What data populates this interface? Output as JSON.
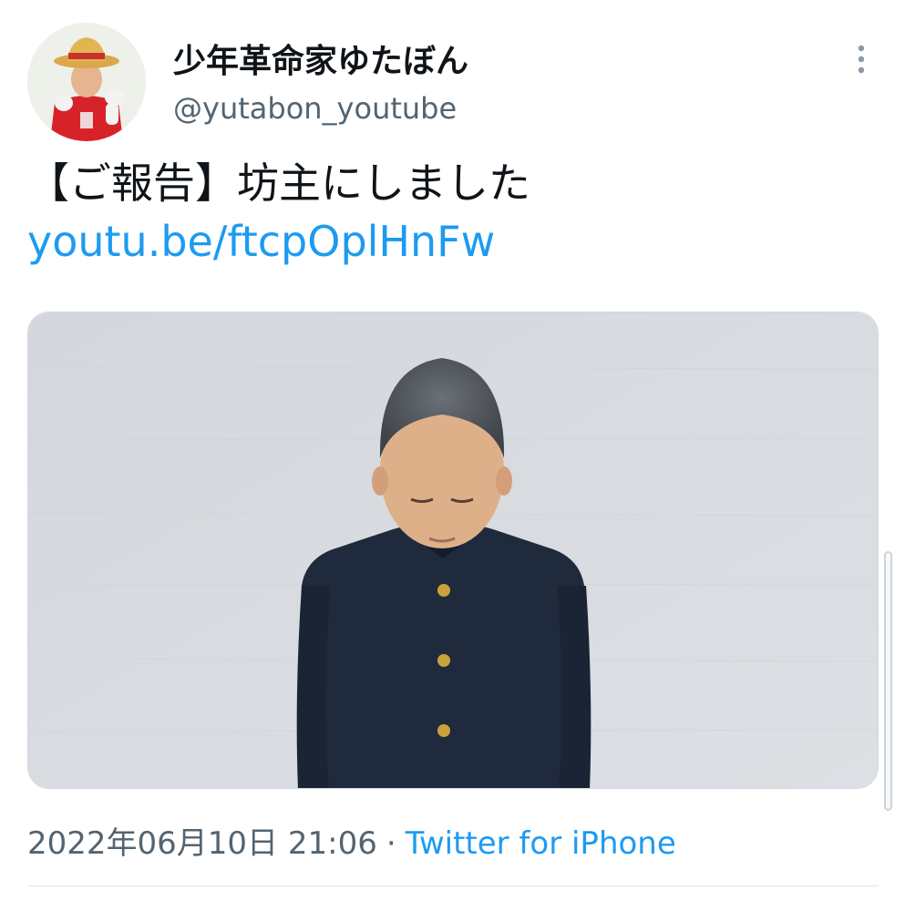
{
  "tweet": {
    "display_name": "少年革命家ゆたぼん",
    "handle": "@yutabon_youtube",
    "text": "【ご報告】坊主にしました",
    "link": "youtu.be/ftcpOplHnFw",
    "date": "2022年06月10日 21:06",
    "separator": "·",
    "source": "Twitter for iPhone",
    "avatar_icon": "avatar-photo-icon",
    "more_icon": "more-vertical-icon"
  },
  "colors": {
    "link": "#1d9bf0",
    "text": "#0f1419",
    "secondary": "#536471"
  }
}
